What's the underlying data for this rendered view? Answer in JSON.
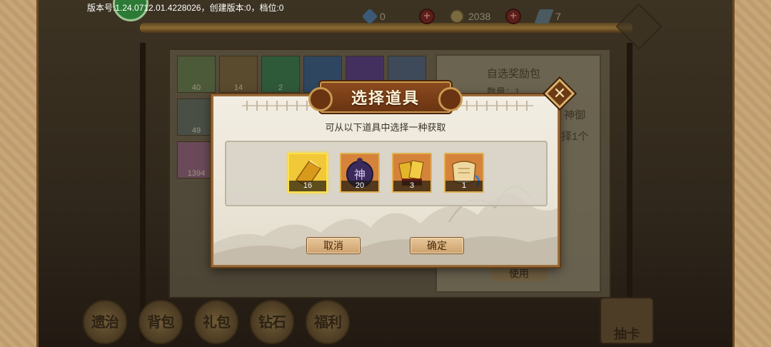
{
  "status_bar": {
    "version_text": "版本号:1.24.0712.01.4228026，创建版本:0，档位:0",
    "resources": [
      {
        "icon": "diamond-icon",
        "value": "0"
      },
      {
        "icon": "coin-icon",
        "value": "2038"
      },
      {
        "icon": "feather-icon",
        "value": "7"
      }
    ]
  },
  "background": {
    "grid_counts": [
      "40",
      "14",
      "2",
      "49",
      "1394"
    ],
    "detail_title": "自选奖励包",
    "detail_qty": "数量：1",
    "detail_text_1": "神御",
    "detail_text_2": "择1个",
    "use_button": "使用",
    "bottom_nav": [
      "遗治",
      "背包",
      "礼包",
      "钻石",
      "福利"
    ],
    "gacha_label": "抽卡"
  },
  "dialog": {
    "title": "选择道具",
    "subtitle": "可从以下道具中选择一种获取",
    "items": [
      {
        "name": "gold-bar-item",
        "count": "16",
        "selected": true
      },
      {
        "name": "shen-token-item",
        "count": "20",
        "selected": false
      },
      {
        "name": "gold-cards-item",
        "count": "3",
        "selected": false
      },
      {
        "name": "scroll-item",
        "count": "1",
        "selected": false
      }
    ],
    "cancel_label": "取消",
    "confirm_label": "确定"
  },
  "colors": {
    "dialog_border": "#9a6b3a",
    "title_banner": "#6a3412",
    "selected_highlight": "#ffe14a",
    "button_fill": "#cda16d"
  }
}
